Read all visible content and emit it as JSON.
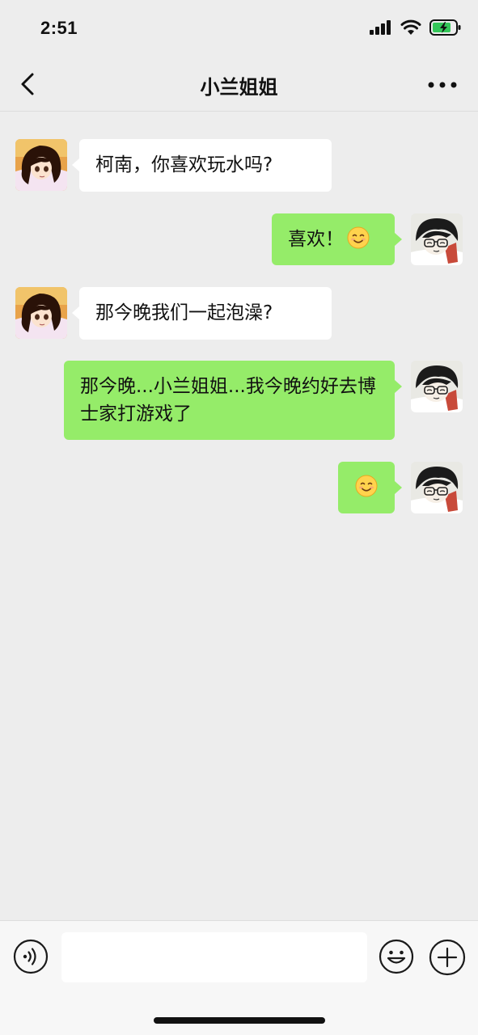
{
  "status_bar": {
    "time": "2:51"
  },
  "nav": {
    "title": "小兰姐姐"
  },
  "messages": [
    {
      "side": "in",
      "text": "柯南，你喜欢玩水吗?"
    },
    {
      "side": "out",
      "text": "喜欢！",
      "emoji": "smile-emoji-icon"
    },
    {
      "side": "in",
      "text": "那今晚我们一起泡澡?"
    },
    {
      "side": "out",
      "text": "那今晚...小兰姐姐...我今晚约好去博士家打游戏了"
    },
    {
      "side": "out",
      "text": "",
      "emoji": "smile-emoji-icon"
    }
  ],
  "colors": {
    "background": "#ededed",
    "incoming_bubble": "#ffffff",
    "outgoing_bubble": "#95ec69"
  },
  "input_bar": {
    "value": "",
    "placeholder": ""
  }
}
